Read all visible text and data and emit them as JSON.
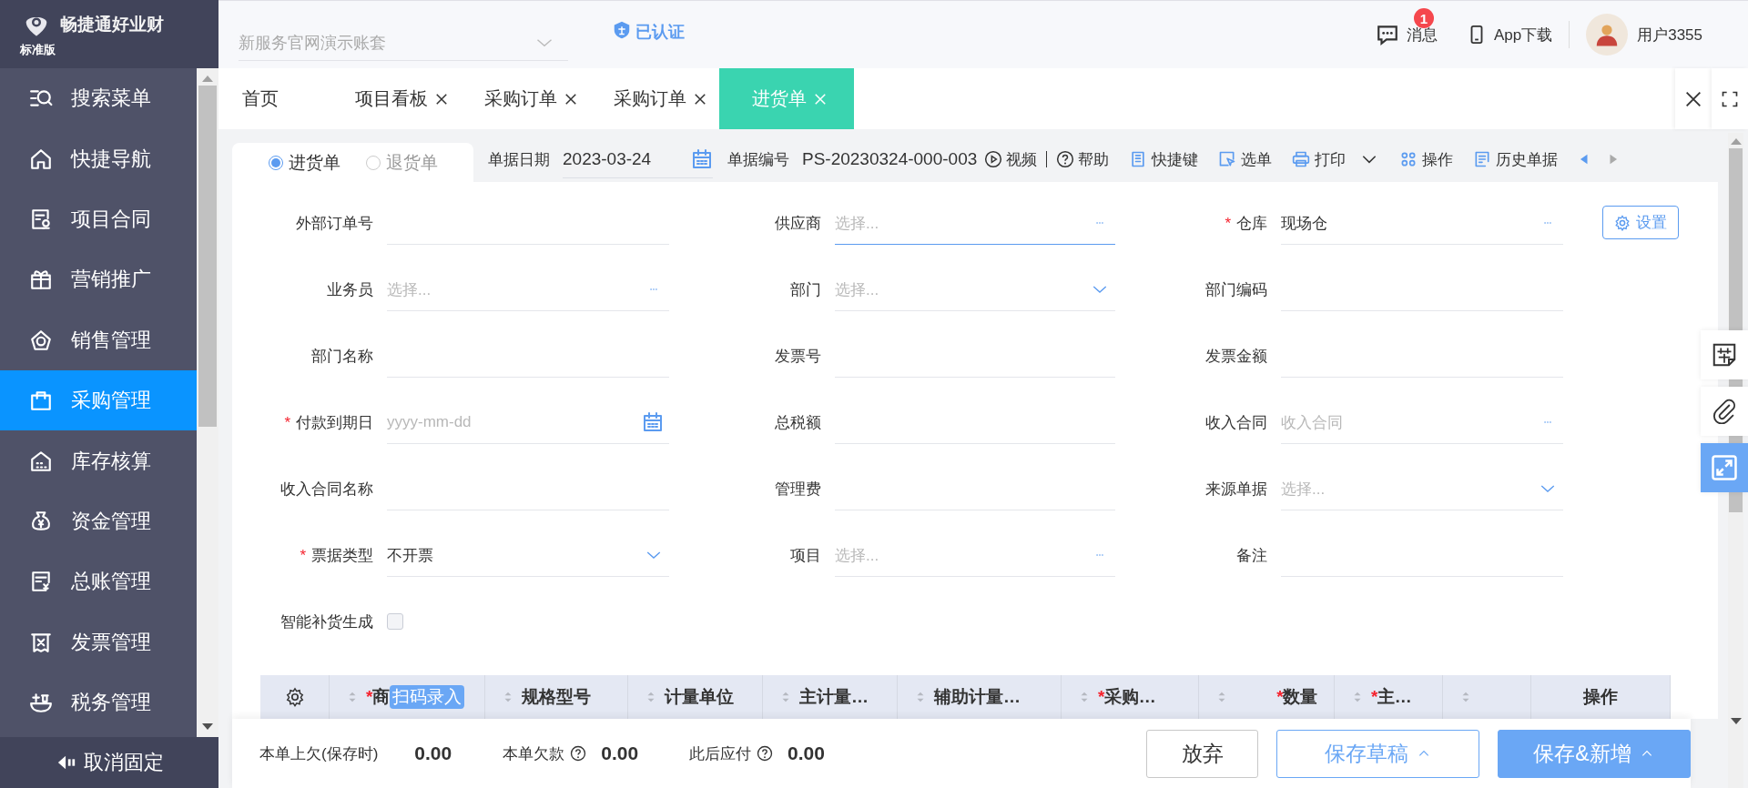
{
  "brand": {
    "name": "畅捷通好业财",
    "edition": "标准版"
  },
  "required_mark": "*",
  "sidebar": {
    "items": [
      {
        "label": "搜索菜单",
        "selected": false
      },
      {
        "label": "快捷导航",
        "selected": false
      },
      {
        "label": "项目合同",
        "selected": false
      },
      {
        "label": "营销推广",
        "selected": false
      },
      {
        "label": "销售管理",
        "selected": false
      },
      {
        "label": "采购管理",
        "selected": true
      },
      {
        "label": "库存核算",
        "selected": false
      },
      {
        "label": "资金管理",
        "selected": false
      },
      {
        "label": "总账管理",
        "selected": false
      },
      {
        "label": "发票管理",
        "selected": false
      },
      {
        "label": "税务管理",
        "selected": false
      }
    ],
    "unpin": "取消固定"
  },
  "header": {
    "account": "新服务官网演示账套",
    "verified": "已认证",
    "messages": {
      "label": "消息",
      "badge": "1"
    },
    "app_download": "App下载",
    "user": "用户3355"
  },
  "tabs": [
    {
      "label": "首页",
      "closable": false,
      "selected": false
    },
    {
      "label": "项目看板",
      "closable": true,
      "selected": false
    },
    {
      "label": "采购订单",
      "closable": true,
      "selected": false
    },
    {
      "label": "采购订单",
      "closable": true,
      "selected": false
    },
    {
      "label": "进货单",
      "closable": true,
      "selected": true
    }
  ],
  "doc_type": [
    {
      "label": "进货单",
      "selected": true
    },
    {
      "label": "退货单",
      "selected": false
    }
  ],
  "doc_date": {
    "label": "单据日期",
    "value": "2023-03-24"
  },
  "doc_number": {
    "label": "单据编号",
    "value": "PS-20230324-000-003"
  },
  "links": [
    "视频",
    "帮助"
  ],
  "toolbar": [
    {
      "label": "快捷键",
      "dropdown": false
    },
    {
      "label": "选单",
      "dropdown": false
    },
    {
      "label": "打印",
      "dropdown": true
    },
    {
      "label": "操作",
      "dropdown": false
    },
    {
      "label": "历史单据",
      "dropdown": false
    }
  ],
  "settings_button": "设置",
  "fields": [
    {
      "label": "外部订单号",
      "kind": "text",
      "required": false,
      "focused": false
    },
    {
      "label": "供应商",
      "kind": "lookup",
      "required": false,
      "focused": true,
      "placeholder": "选择..."
    },
    {
      "label": "仓库",
      "kind": "lookup",
      "required": true,
      "focused": false,
      "value": "现场仓"
    },
    {
      "label": "业务员",
      "kind": "lookup",
      "required": false,
      "focused": false,
      "placeholder": "选择..."
    },
    {
      "label": "部门",
      "kind": "select",
      "required": false,
      "focused": false,
      "placeholder": "选择..."
    },
    {
      "label": "部门编码",
      "kind": "text",
      "required": false,
      "focused": false
    },
    {
      "label": "部门名称",
      "kind": "text",
      "required": false,
      "focused": false
    },
    {
      "label": "发票号",
      "kind": "text",
      "required": false,
      "focused": false
    },
    {
      "label": "发票金额",
      "kind": "text",
      "required": false,
      "focused": false
    },
    {
      "label": "付款到期日",
      "kind": "date",
      "required": true,
      "focused": false,
      "placeholder": "yyyy-mm-dd"
    },
    {
      "label": "总税额",
      "kind": "text",
      "required": false,
      "focused": false
    },
    {
      "label": "收入合同",
      "kind": "lookup",
      "required": false,
      "focused": false,
      "placeholder": "收入合同"
    },
    {
      "label": "收入合同名称",
      "kind": "text",
      "required": false,
      "focused": false
    },
    {
      "label": "管理费",
      "kind": "text",
      "required": false,
      "focused": false
    },
    {
      "label": "来源单据",
      "kind": "select",
      "required": false,
      "focused": false,
      "placeholder": "选择..."
    },
    {
      "label": "票据类型",
      "kind": "select",
      "required": true,
      "focused": false,
      "value": "不开票"
    },
    {
      "label": "项目",
      "kind": "lookup",
      "required": false,
      "focused": false,
      "placeholder": "选择..."
    },
    {
      "label": "备注",
      "kind": "text",
      "required": false,
      "focused": false
    },
    {
      "label": "智能补货生成",
      "kind": "checkbox",
      "checked": false
    }
  ],
  "table": {
    "columns": [
      {
        "kind": "gear"
      },
      {
        "label": "商",
        "required": true,
        "sortable": true,
        "tag": "扫码录入"
      },
      {
        "label": "规格型号",
        "required": false,
        "sortable": true
      },
      {
        "label": "计量单位",
        "required": false,
        "sortable": true
      },
      {
        "label": "主计量…",
        "required": false,
        "sortable": true
      },
      {
        "label": "辅助计量…",
        "required": false,
        "sortable": true
      },
      {
        "label": "采购…",
        "required": true,
        "sortable": true
      },
      {
        "label": "数量",
        "required": true,
        "sortable": true
      },
      {
        "label": "主…",
        "required": true,
        "sortable": true
      },
      {
        "required": false,
        "sortable": true
      },
      {
        "label": "操作",
        "required": false,
        "sortable": false
      }
    ]
  },
  "footer": {
    "summary": [
      {
        "label": "本单上欠(保存时)",
        "value": "0.00",
        "help": false
      },
      {
        "label": "本单欠款",
        "value": "0.00",
        "help": true
      },
      {
        "label": "此后应付",
        "value": "0.00",
        "help": true
      }
    ],
    "buttons": [
      {
        "label": "放弃",
        "kind": "plain",
        "dropdown": false
      },
      {
        "label": "保存草稿",
        "kind": "outline",
        "dropdown": true
      },
      {
        "label": "保存&新增",
        "kind": "primary",
        "dropdown": true
      }
    ]
  }
}
